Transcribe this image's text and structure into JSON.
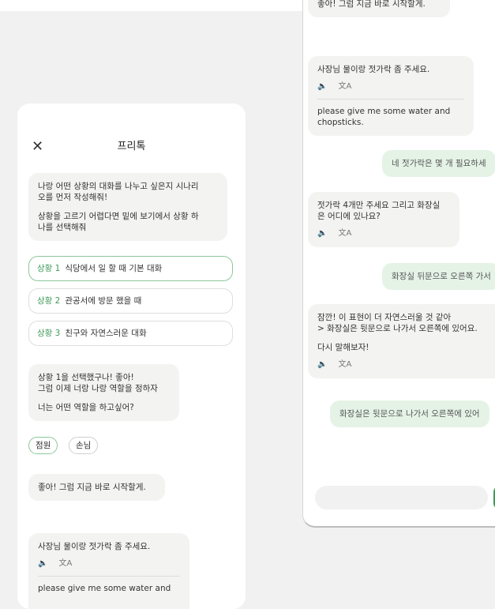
{
  "header": {
    "title": "프리톡"
  },
  "left": {
    "intro": {
      "line1": "나랑 어떤 상황의 대화를 나누고 싶은지 시나리",
      "line2": "오를 먼저 작성해줘!",
      "line3": "상황을 고르기 어렵다면 밑에 보기에서 상황 하",
      "line4": "나를 선택해줘"
    },
    "scenarios": [
      {
        "label": "상황 1",
        "text": "식당에서 일 할 때 기본 대화"
      },
      {
        "label": "상황 2",
        "text": "관공서에 방문 했을 때"
      },
      {
        "label": "상황 3",
        "text": "친구와 자연스러운 대화"
      }
    ],
    "selected": {
      "line1": "상황 1을 선택했구나! 좋아!",
      "line2": "그럼 이제 너랑 나랑 역할을 정하자",
      "line3": "너는 어떤 역할을 하고싶어?"
    },
    "roles": [
      "점원",
      "손님"
    ],
    "start": "좋아! 그럼 지금 바로 시작할게.",
    "msg": {
      "ko": "사장님 물이랑 젓가락 좀 주세요.",
      "en": "please give me some water and"
    }
  },
  "right": {
    "top_partial": "좋아! 그럼 지금 바로 시작할게.",
    "msg1": {
      "ko": "사장님 물이랑 젓가락 좀 주세요.",
      "en1": "please give me some water and",
      "en2": "chopsticks."
    },
    "user1": "네 젓가락은 몇 개 필요하세",
    "msg2": {
      "line1": "젓가락 4개만 주세요 그리고 화장실",
      "line2": "은 어디에 있나요?"
    },
    "user2": "화장실 뒤문으로 오른쪽 가서",
    "msg3": {
      "line1": "잠깐! 이 표현이 더 자연스러울 것 같아",
      "line2": "> 화장실은 뒷문으로 나가서 오른쪽에 있어요.",
      "line3": "다시 말해보자!"
    },
    "user3": "화장실은 뒷문으로 나가서 오른쪽에 있어"
  },
  "icons": {
    "speaker": "🔈",
    "translate": "文A",
    "close": "✕"
  },
  "colors": {
    "accent": "#3e9a57",
    "bot_bubble": "#f3f3f1",
    "user_bubble": "#e5f3e7"
  }
}
